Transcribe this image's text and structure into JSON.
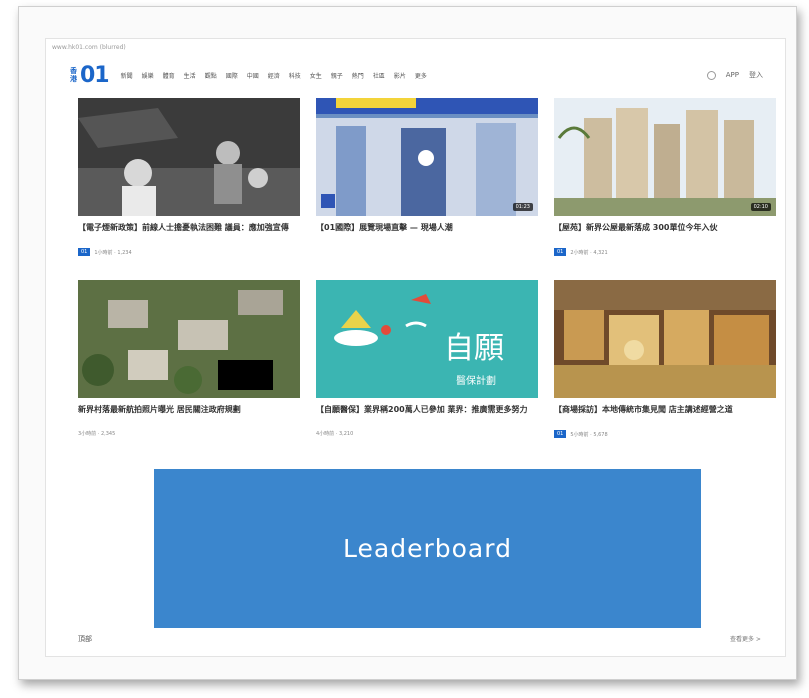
{
  "url": "www.hk01.com (blurred)",
  "logo": {
    "small_top": "香",
    "small_bottom": "港",
    "main": "01"
  },
  "nav": [
    "新聞",
    "娛樂",
    "體育",
    "生活",
    "觀點",
    "國際",
    "中國",
    "經濟",
    "科技",
    "女生",
    "親子",
    "熱門",
    "社區",
    "影片",
    "更多"
  ],
  "header_right": {
    "app": "APP",
    "login": "登入"
  },
  "cards": [
    {
      "title": "【電子煙新政策】前線人士擔憂執法困難 議員：應加強宣傳",
      "tag": "01",
      "meta": "1小時前 · 1,234",
      "duration": ""
    },
    {
      "title": "【01國際】展覽現場直擊 — 現場人潮",
      "tag": "",
      "meta": "",
      "duration": "01:23"
    },
    {
      "title": "【屋苑】新界公屋最新落成 300單位今年入伙",
      "tag": "01",
      "meta": "2小時前 · 4,321",
      "duration": "02:10"
    },
    {
      "title": "新界村落最新航拍照片曝光 居民關注政府規劃",
      "tag": "",
      "meta": "3小時前 · 2,345",
      "duration": ""
    },
    {
      "title": "【自願醫保】業界稱200萬人已參加 業界：推廣需更多努力",
      "tag": "",
      "meta": "4小時前 · 3,210",
      "duration": ""
    },
    {
      "title": "【商場採訪】本地傳統市集見聞 店主講述經營之道",
      "tag": "01",
      "meta": "5小時前 · 5,678",
      "duration": ""
    }
  ],
  "ad": {
    "label": "Leaderboard"
  },
  "footer": {
    "left": "頂部",
    "right": "查看更多 >"
  }
}
